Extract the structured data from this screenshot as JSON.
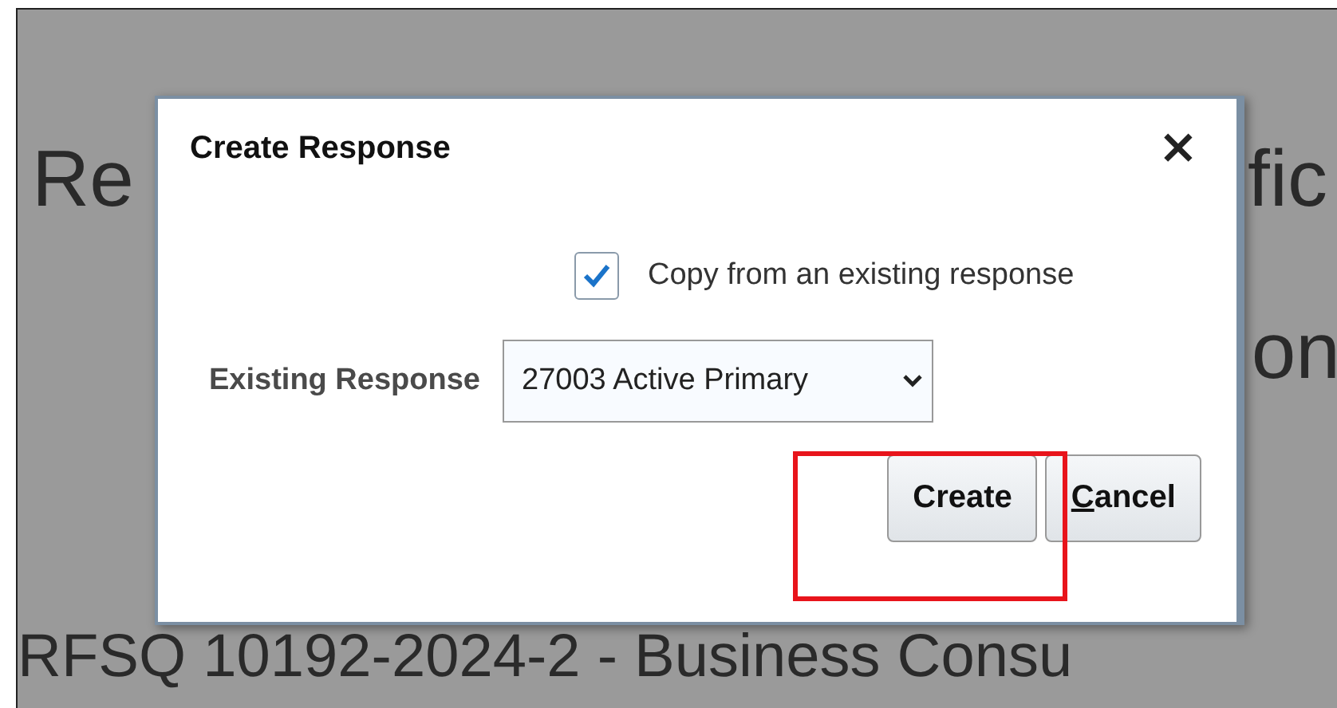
{
  "background": {
    "heading_left": "Re",
    "heading_right": "fic",
    "line_2_right": "on",
    "subtitle": "RFSQ 10192-2024-2 - Business Consu"
  },
  "dialog": {
    "title": "Create Response",
    "close": "×",
    "checkbox": {
      "label": "Copy from an existing response",
      "checked": true
    },
    "field": {
      "label": "Existing Response",
      "value": "27003 Active Primary"
    },
    "buttons": [
      {
        "label": "Create",
        "access_key_underlined": false
      },
      {
        "label": "Cancel",
        "access_key_underlined": true
      }
    ]
  },
  "annotation": {
    "kind": "highlight",
    "color": "#e8141b"
  }
}
